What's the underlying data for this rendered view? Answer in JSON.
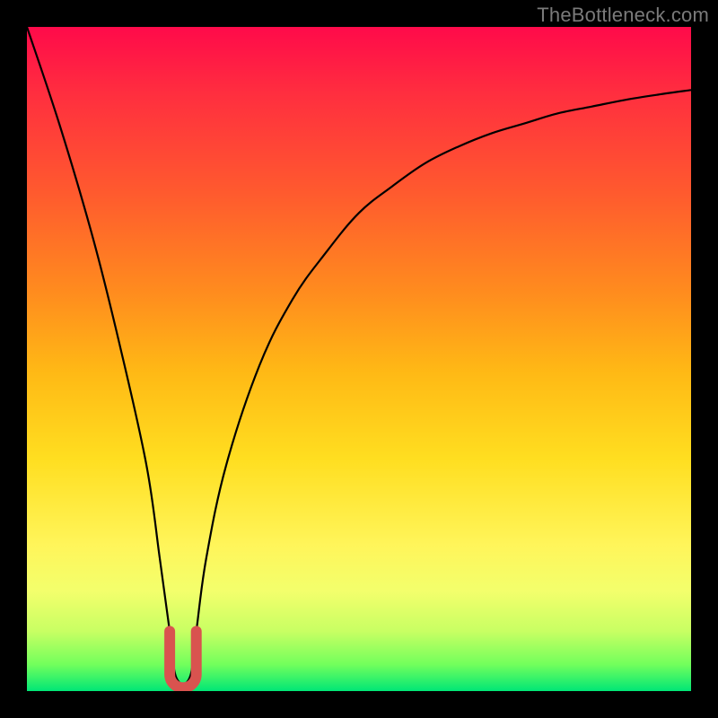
{
  "watermark": "TheBottleneck.com",
  "chart_data": {
    "type": "line",
    "title": "",
    "xlabel": "",
    "ylabel": "",
    "xlim": [
      0,
      100
    ],
    "ylim": [
      0,
      100
    ],
    "grid": false,
    "legend": false,
    "series": [
      {
        "name": "bottleneck-curve",
        "color": "#000000",
        "x": [
          0,
          5,
          10,
          14,
          18,
          20,
          21.5,
          22.5,
          24.5,
          25.5,
          27,
          30,
          35,
          40,
          45,
          50,
          55,
          60,
          65,
          70,
          75,
          80,
          85,
          90,
          95,
          100
        ],
        "values": [
          100,
          85,
          68,
          52,
          34,
          20,
          9,
          2,
          2,
          9,
          20,
          34,
          49,
          59,
          66,
          72,
          76,
          79.5,
          82,
          84,
          85.5,
          87,
          88,
          89,
          89.8,
          90.5
        ]
      },
      {
        "name": "optimal-marker",
        "type": "u-marker",
        "color": "#d9534f",
        "x_range": [
          21.5,
          25.5
        ],
        "y_range": [
          0.5,
          9
        ],
        "note": "Red U marking the bottleneck-free region near x≈23.5"
      }
    ],
    "background_gradient": {
      "top": "#ff0a4a",
      "mid_high": "#ff8c1e",
      "mid": "#ffde20",
      "mid_low": "#f3ff6c",
      "bottom": "#00e676",
      "meaning": "red = high bottleneck, green = low bottleneck"
    }
  }
}
